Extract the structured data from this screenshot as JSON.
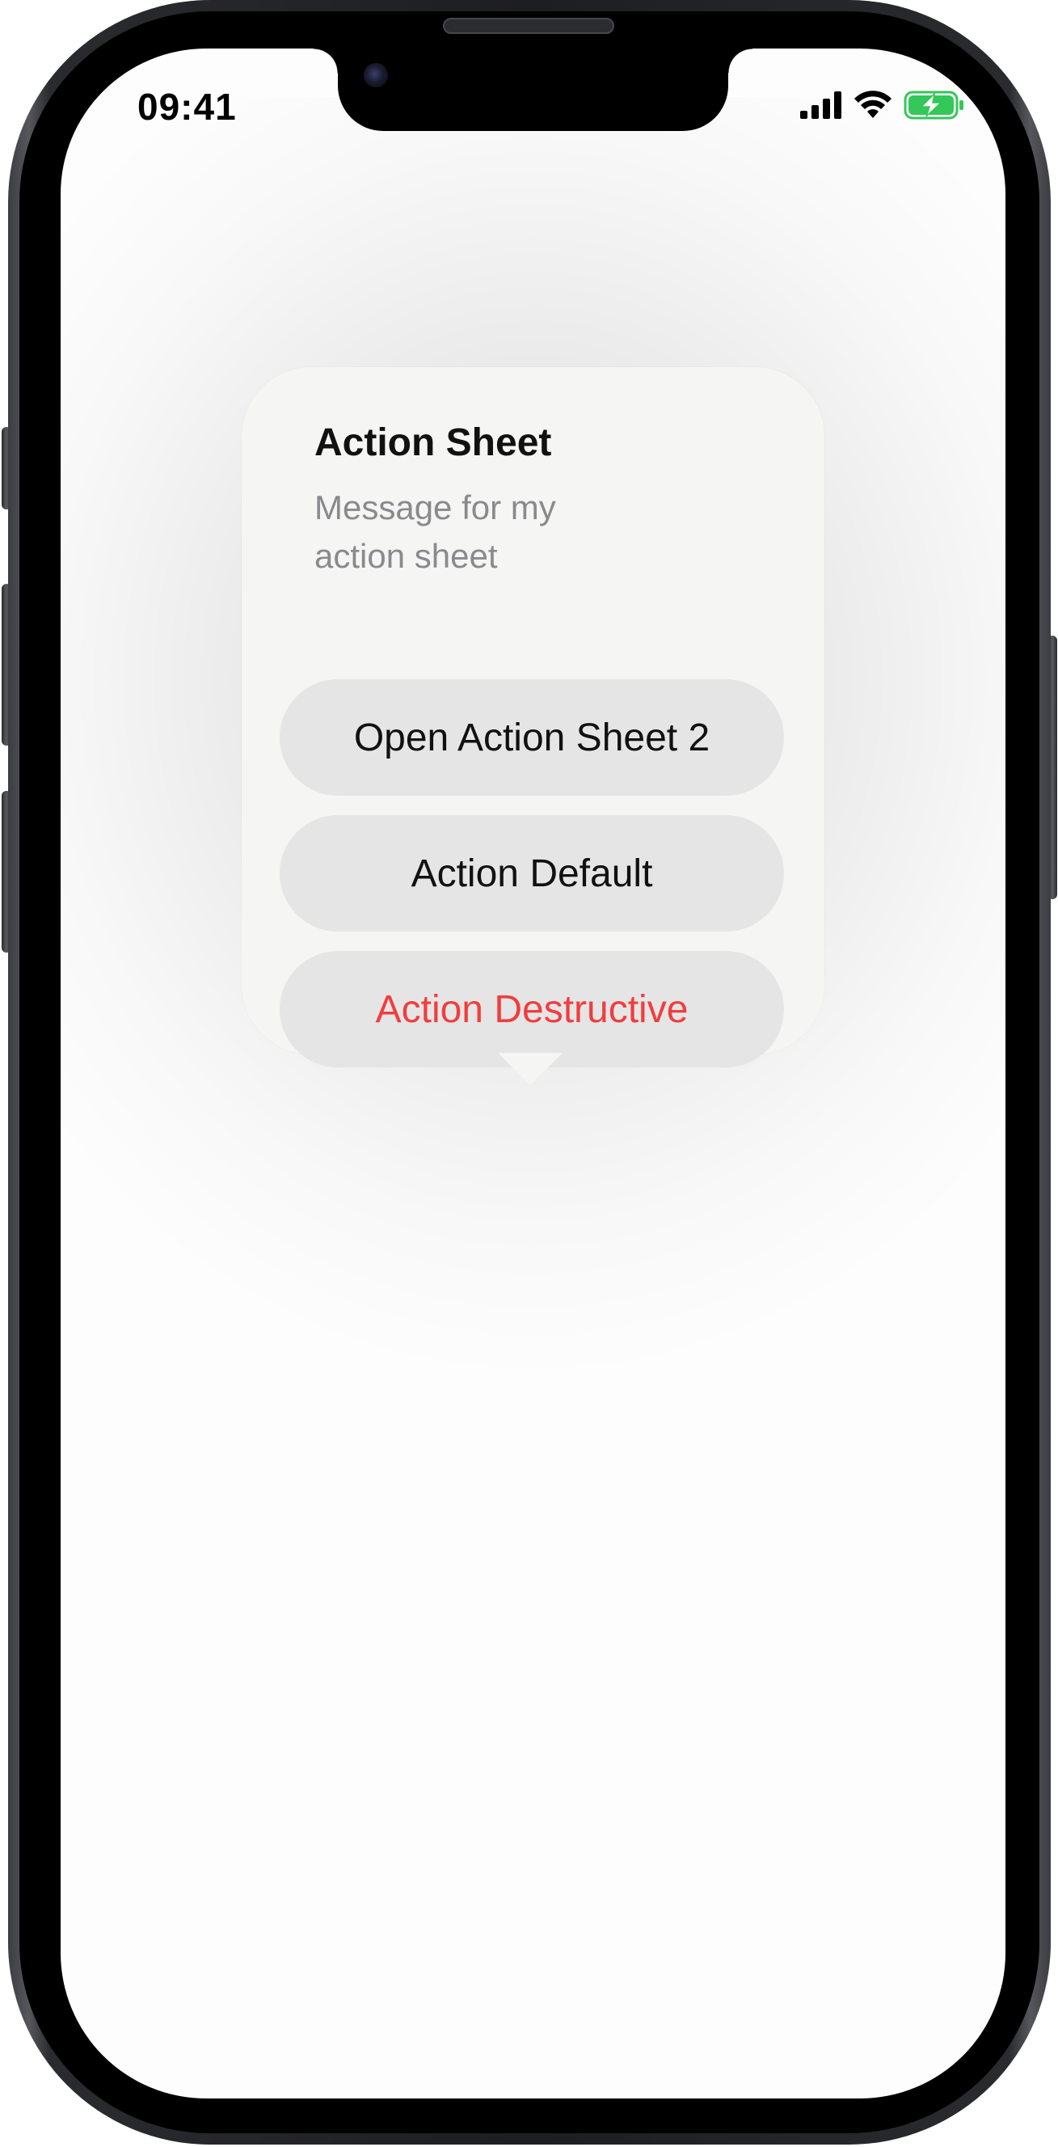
{
  "status_bar": {
    "time": "09:41",
    "icons": [
      "cellular-signal-icon",
      "wifi-icon",
      "battery-charging-icon"
    ],
    "battery_color": "#34c759"
  },
  "action_sheet": {
    "title": "Action Sheet",
    "message": "Message for my action sheet",
    "actions": [
      {
        "label": "Open Action Sheet 2",
        "style": "default"
      },
      {
        "label": "Action Default",
        "style": "default"
      },
      {
        "label": "Action Destructive",
        "style": "destructive"
      }
    ]
  },
  "colors": {
    "destructive": "#ef3e3f",
    "button_bg": "#e5e5e5",
    "sheet_bg": "#f5f5f4"
  }
}
